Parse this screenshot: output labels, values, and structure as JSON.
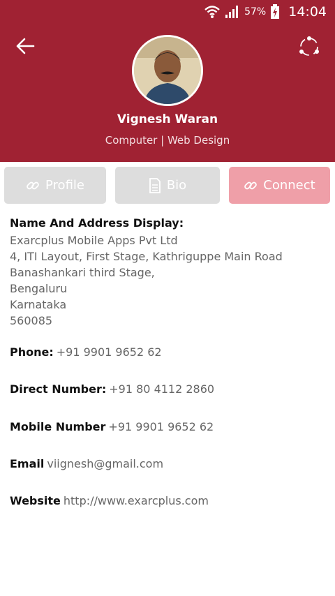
{
  "status": {
    "battery": "57%",
    "time": "14:04"
  },
  "profile": {
    "name": "Vignesh Waran",
    "subtitle": "Computer | Web Design"
  },
  "tabs": [
    {
      "label": "Profile",
      "icon": "link-icon",
      "state": "inactive"
    },
    {
      "label": "Bio",
      "icon": "document-icon",
      "state": "inactive"
    },
    {
      "label": "Connect",
      "icon": "link-icon",
      "state": "active"
    }
  ],
  "address": {
    "label": "Name And Address Display:",
    "lines": [
      "Exarcplus Mobile Apps Pvt Ltd",
      "4, ITI Layout, First Stage, Kathriguppe Main Road",
      "Banashankari third Stage,",
      "Bengaluru",
      "Karnataka",
      "560085"
    ]
  },
  "fields": [
    {
      "key": "Phone:",
      "value": "+91 9901 9652 62"
    },
    {
      "key": "Direct Number:",
      "value": "+91 80 4112 2860"
    },
    {
      "key": "Mobile Number",
      "value": "+91 9901 9652 62"
    },
    {
      "key": "Email",
      "value": "viignesh@gmail.com"
    },
    {
      "key": "Website",
      "value": "http://www.exarcplus.com"
    }
  ],
  "colors": {
    "header": "#a02233",
    "tab_active": "#ef9fa8",
    "tab_inactive": "#dddddd"
  }
}
